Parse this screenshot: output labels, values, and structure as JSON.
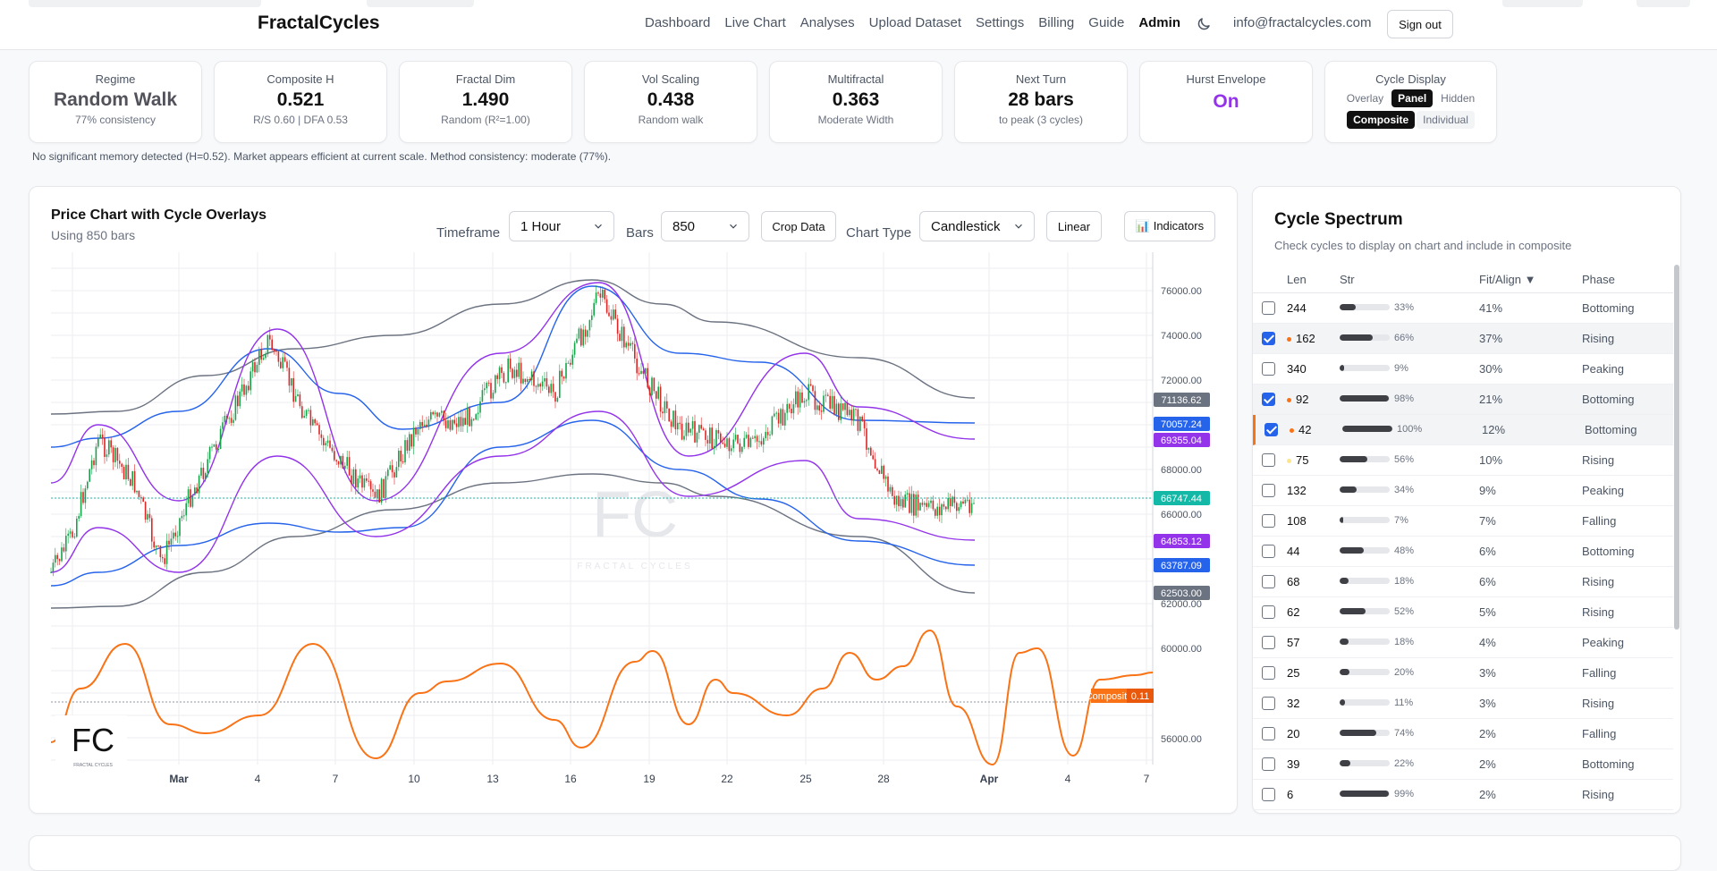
{
  "header": {
    "brand": "FractalCycles",
    "nav": [
      "Dashboard",
      "Live Chart",
      "Analyses",
      "Upload Dataset",
      "Settings",
      "Billing",
      "Guide",
      "Admin"
    ],
    "active": "Admin",
    "email": "info@fractalcycles.com",
    "signout": "Sign out"
  },
  "stats": [
    {
      "label": "Regime",
      "value": "Random Walk",
      "sub": "77% consistency"
    },
    {
      "label": "Composite H",
      "value": "0.521",
      "sub": "R/S 0.60 | DFA 0.53"
    },
    {
      "label": "Fractal Dim",
      "value": "1.490",
      "sub": "Random (R²=1.00)"
    },
    {
      "label": "Vol Scaling",
      "value": "0.438",
      "sub": "Random walk"
    },
    {
      "label": "Multifractal",
      "value": "0.363",
      "sub": "Moderate Width"
    },
    {
      "label": "Next Turn",
      "value": "28 bars",
      "sub": "to peak (3 cycles)"
    },
    {
      "label": "Hurst Envelope",
      "value": "On"
    }
  ],
  "cycle_display": {
    "label": "Cycle Display",
    "row1": [
      "Overlay",
      "Panel",
      "Hidden"
    ],
    "row1_active": "Panel",
    "row2": [
      "Composite",
      "Individual"
    ],
    "row2_active": "Composite"
  },
  "note": "No significant memory detected (H=0.52). Market appears efficient at current scale. Method consistency: moderate (77%).",
  "chart": {
    "title": "Price Chart with Cycle Overlays",
    "subtitle": "Using 850 bars",
    "timeframe_label": "Timeframe",
    "timeframe": "1 Hour",
    "bars_label": "Bars",
    "bars": "850",
    "crop": "Crop Data",
    "type_label": "Chart Type",
    "type": "Candlestick",
    "scale": "Linear",
    "indicators": "📊 Indicators",
    "y_ticks": [
      "76000.00",
      "74000.00",
      "72000.00",
      "68000.00",
      "66000.00",
      "62000.00",
      "60000.00",
      "56000.00"
    ],
    "x_ticks": [
      "Mar",
      "4",
      "7",
      "10",
      "13",
      "16",
      "19",
      "22",
      "25",
      "28",
      "Apr",
      "4",
      "7"
    ],
    "tags": [
      {
        "text": "71136.62",
        "color": "#6b7280"
      },
      {
        "text": "70057.24",
        "color": "#2563eb"
      },
      {
        "text": "69355.04",
        "color": "#9333ea"
      },
      {
        "text": "66747.44",
        "color": "#14b8a6"
      },
      {
        "text": "64853.12",
        "color": "#9333ea"
      },
      {
        "text": "63787.09",
        "color": "#2563eb"
      },
      {
        "text": "62503.00",
        "color": "#6b7280"
      }
    ],
    "composite_label": "Composite",
    "composite_value": "0.11",
    "watermark": "FRACTAL CYCLES",
    "logo_text": "FRACTAL CYCLES"
  },
  "spectrum": {
    "title": "Cycle Spectrum",
    "subtitle": "Check cycles to display on chart and include in composite",
    "headers": [
      "Len",
      "Str",
      "Fit/Align ▼",
      "Phase"
    ],
    "rows": [
      {
        "len": "244",
        "str": 33,
        "str_label": "33%",
        "fit": "41%",
        "phase": "Bottoming",
        "checked": false
      },
      {
        "len": "162",
        "str": 66,
        "str_label": "66%",
        "fit": "37%",
        "phase": "Rising",
        "checked": true,
        "dot": "#f97316"
      },
      {
        "len": "340",
        "str": 9,
        "str_label": "9%",
        "fit": "30%",
        "phase": "Peaking",
        "checked": false
      },
      {
        "len": "92",
        "str": 98,
        "str_label": "98%",
        "fit": "21%",
        "phase": "Bottoming",
        "checked": true,
        "dot": "#f97316"
      },
      {
        "len": "42",
        "str": 100,
        "str_label": "100%",
        "fit": "12%",
        "phase": "Bottoming",
        "checked": true,
        "dot": "#f97316",
        "highlight": true
      },
      {
        "len": "75",
        "str": 56,
        "str_label": "56%",
        "fit": "10%",
        "phase": "Rising",
        "checked": false,
        "dot": "#fde68a"
      },
      {
        "len": "132",
        "str": 34,
        "str_label": "34%",
        "fit": "9%",
        "phase": "Peaking",
        "checked": false
      },
      {
        "len": "108",
        "str": 7,
        "str_label": "7%",
        "fit": "7%",
        "phase": "Falling",
        "checked": false
      },
      {
        "len": "44",
        "str": 48,
        "str_label": "48%",
        "fit": "6%",
        "phase": "Bottoming",
        "checked": false
      },
      {
        "len": "68",
        "str": 18,
        "str_label": "18%",
        "fit": "6%",
        "phase": "Rising",
        "checked": false
      },
      {
        "len": "62",
        "str": 52,
        "str_label": "52%",
        "fit": "5%",
        "phase": "Rising",
        "checked": false
      },
      {
        "len": "57",
        "str": 18,
        "str_label": "18%",
        "fit": "4%",
        "phase": "Peaking",
        "checked": false
      },
      {
        "len": "25",
        "str": 20,
        "str_label": "20%",
        "fit": "3%",
        "phase": "Falling",
        "checked": false
      },
      {
        "len": "32",
        "str": 11,
        "str_label": "11%",
        "fit": "3%",
        "phase": "Rising",
        "checked": false
      },
      {
        "len": "20",
        "str": 74,
        "str_label": "74%",
        "fit": "2%",
        "phase": "Falling",
        "checked": false
      },
      {
        "len": "39",
        "str": 22,
        "str_label": "22%",
        "fit": "2%",
        "phase": "Bottoming",
        "checked": false
      },
      {
        "len": "6",
        "str": 99,
        "str_label": "99%",
        "fit": "2%",
        "phase": "Rising",
        "checked": false
      }
    ]
  }
}
